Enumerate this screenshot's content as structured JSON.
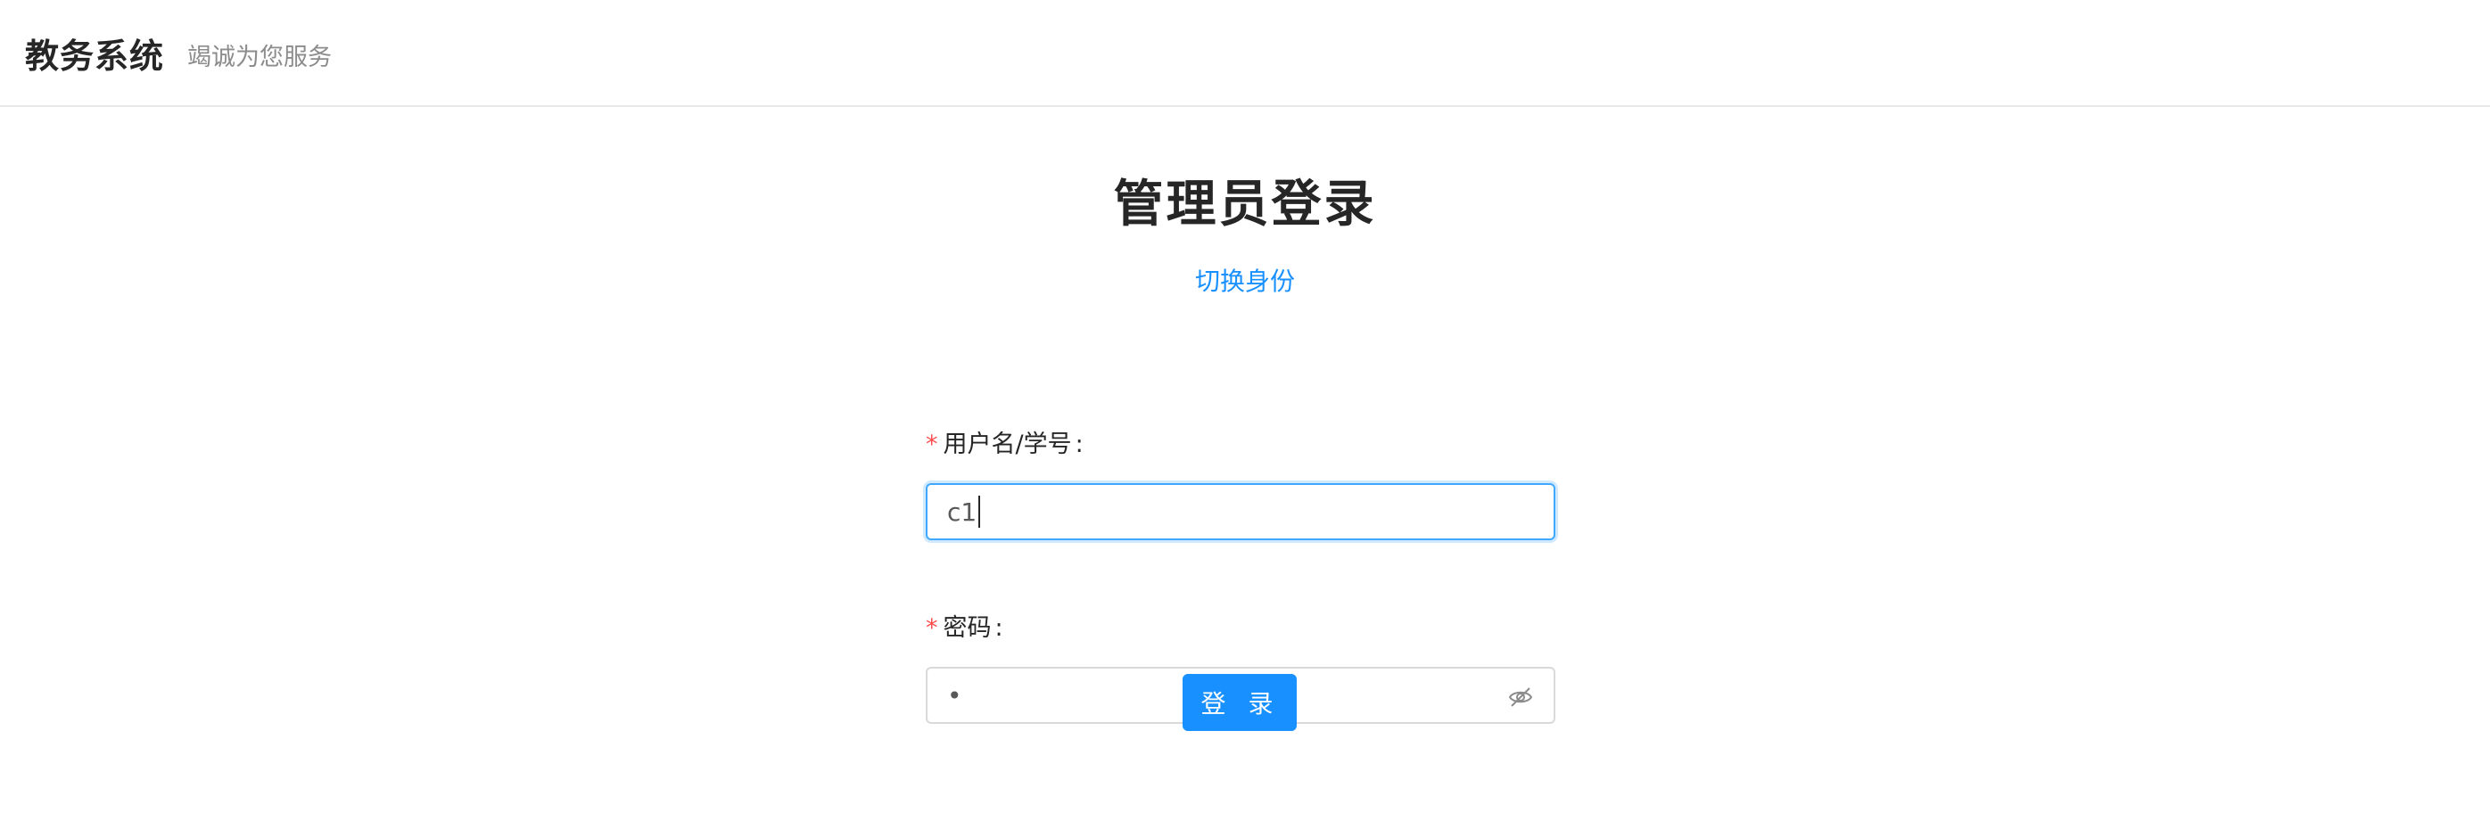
{
  "header": {
    "brand": "教务系统",
    "slogan": "竭诚为您服务"
  },
  "login": {
    "title": "管理员登录",
    "switch_identity": "切换身份",
    "username": {
      "required_mark": "*",
      "label": "用户名/学号",
      "colon": ":",
      "value": "c1"
    },
    "password": {
      "required_mark": "*",
      "label": "密码",
      "colon": ":",
      "masked_value": "•",
      "toggle_icon": "eye-invisible-icon"
    },
    "submit_label": "登 录"
  },
  "colors": {
    "primary": "#1890ff",
    "required": "#ff4d4f",
    "focus_border": "#40a9ff",
    "border": "#d9d9d9",
    "muted_text": "#8c8c8c"
  }
}
